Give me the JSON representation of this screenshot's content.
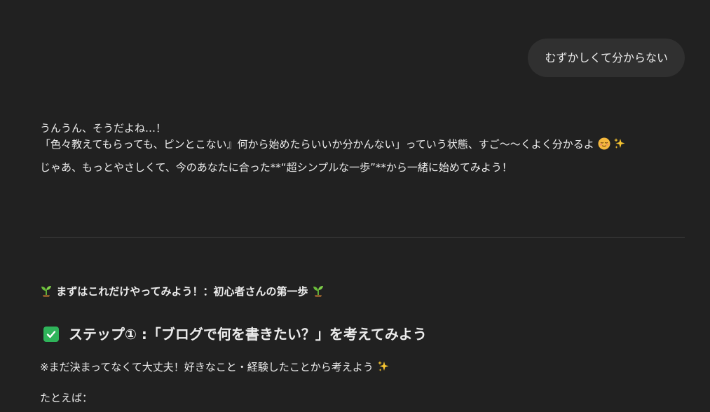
{
  "user_message": "むずかしくて分からない",
  "reply": {
    "line1": "うんうん、そうだよね…！",
    "line2_text": "「色々教えてもらっても、ピンとこない』何から始めたらいいか分かんない」っていう状態、すご〜〜くよく分かるよ",
    "line3": "じゃあ、もっとやさしくて、今のあなたに合った**“超シンプルな一歩”**から一緒に始めてみよう！"
  },
  "section": {
    "title": "まずはこれだけやってみよう！：初心者さんの第一歩"
  },
  "step": {
    "title": "ステップ① :「ブログで何を書きたい？」を考えてみよう",
    "note": "※まだ決まってなくて大丈夫！好きなこと・経験したことから考えよう",
    "example_label": "たとえば："
  },
  "icons": {
    "section_left": "sprout-icon",
    "section_right": "sprout-icon",
    "step_check": "check-box-icon",
    "line2_face": "relieved-face-icon",
    "line2_sparkle": "sparkles-icon",
    "note_sparkle": "sparkles-icon"
  },
  "colors": {
    "background": "#212121",
    "user_bubble": "#303030",
    "text": "#ececec",
    "check_green": "#2fb45a",
    "divider": "#3f3f3f"
  }
}
